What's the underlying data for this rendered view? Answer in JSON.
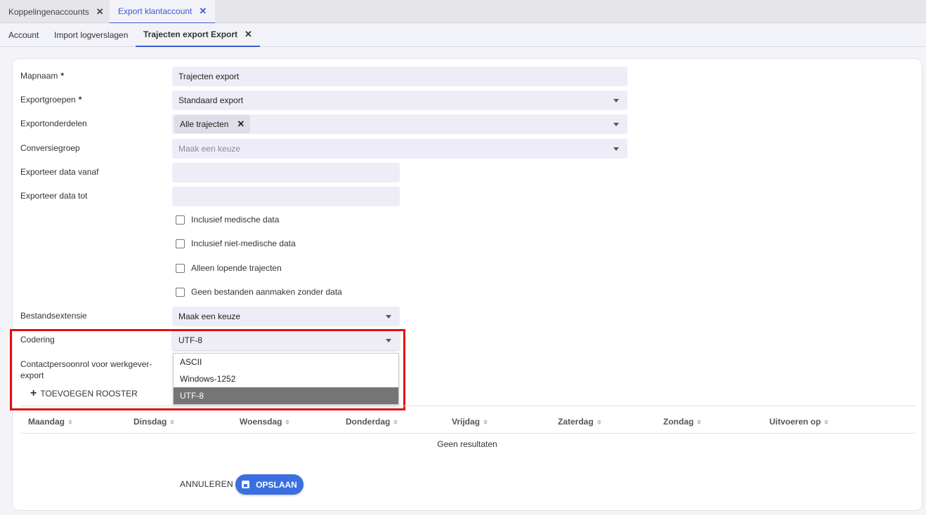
{
  "top_tabs": [
    {
      "label": "Koppelingenaccounts",
      "close": "✕"
    },
    {
      "label": "Export klantaccount",
      "close": "✕"
    }
  ],
  "sub_tabs": [
    {
      "label": "Account"
    },
    {
      "label": "Import logverslagen"
    },
    {
      "label": "Trajecten export Export",
      "close": "✕"
    }
  ],
  "form": {
    "mapnaam": {
      "label": "Mapnaam",
      "required": "*",
      "value": "Trajecten export"
    },
    "exportgroepen": {
      "label": "Exportgroepen",
      "required": "*",
      "value": "Standaard export"
    },
    "exportonderdelen": {
      "label": "Exportonderdelen",
      "chip": "Alle trajecten",
      "chip_close": "✕"
    },
    "conversiegroep": {
      "label": "Conversiegroep",
      "placeholder": "Maak een keuze"
    },
    "data_vanaf": {
      "label": "Exporteer data vanaf",
      "value": ""
    },
    "data_tot": {
      "label": "Exporteer data tot",
      "value": ""
    },
    "checkboxes": [
      {
        "label": "Inclusief medische data",
        "checked": false
      },
      {
        "label": "Inclusief niet-medische data",
        "checked": false
      },
      {
        "label": "Alleen lopende trajecten",
        "checked": false
      },
      {
        "label": "Geen bestanden aanmaken zonder data",
        "checked": false
      }
    ],
    "bestandsextensie": {
      "label": "Bestandsextensie",
      "value": "Maak een keuze"
    },
    "codering": {
      "label": "Codering",
      "value": "UTF-8",
      "options": [
        "ASCII",
        "Windows-1252",
        "UTF-8"
      ],
      "selected": "UTF-8"
    },
    "contactpersoonrol": {
      "label_line1": "Contactpersoonrol voor werkgever-",
      "label_line2": "export"
    }
  },
  "roster": {
    "add_label": "TOEVOEGEN ROOSTER",
    "columns": [
      "Maandag",
      "Dinsdag",
      "Woensdag",
      "Donderdag",
      "Vrijdag",
      "Zaterdag",
      "Zondag",
      "Uitvoeren op"
    ],
    "empty_text": "Geen resultaten"
  },
  "actions": {
    "cancel": "ANNULEREN",
    "save": "OPSLAAN"
  },
  "colors": {
    "accent": "#3a6fe0",
    "highlight": "#e01010",
    "selected_option": "#757575"
  }
}
